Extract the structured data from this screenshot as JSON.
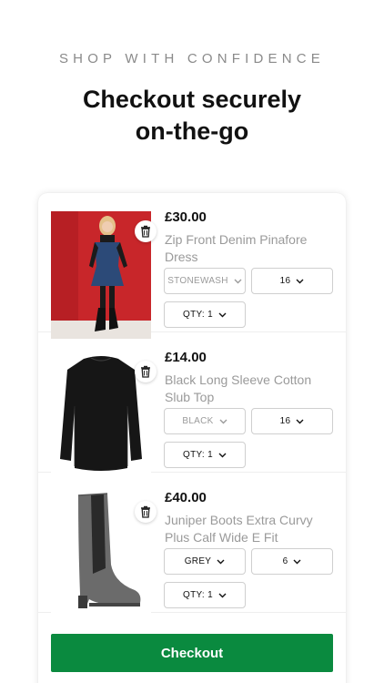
{
  "header": {
    "tagline": "SHOP WITH CONFIDENCE",
    "headline_line1": "Checkout securely",
    "headline_line2": "on-the-go"
  },
  "cart": {
    "items": [
      {
        "price": "£30.00",
        "name": "Zip Front Denim Pinafore Dress",
        "colour": "STONEWASH",
        "size": "16",
        "qty": "QTY: 1"
      },
      {
        "price": "£14.00",
        "name": "Black Long Sleeve Cotton Slub Top",
        "colour": "BLACK",
        "size": "16",
        "qty": "QTY: 1"
      },
      {
        "price": "£40.00",
        "name": "Juniper Boots Extra Curvy Plus Calf Wide E Fit",
        "colour": "GREY",
        "size": "6",
        "qty": "QTY: 1"
      }
    ],
    "checkout_label": "Checkout"
  },
  "colors": {
    "checkout_button": "#0a8a3f",
    "tagline": "#8a8a8a",
    "product_name": "#9a9a9a"
  },
  "icons": {
    "delete": "trash-icon",
    "dropdown": "chevron-down-icon"
  }
}
